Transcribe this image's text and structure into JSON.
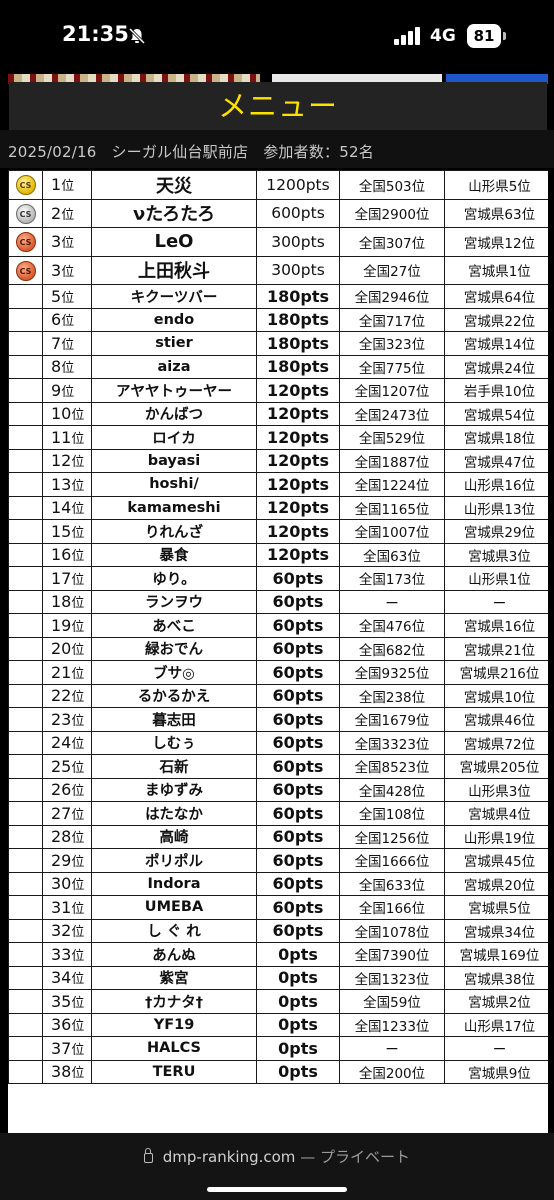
{
  "status_bar": {
    "time": "21:35",
    "network": "4G",
    "battery": "81",
    "icons": [
      "bell-slash-icon",
      "signal-icon",
      "battery-icon"
    ]
  },
  "header": {
    "menu_title": "メニュー",
    "date": "2025/02/16",
    "store": "シーガル仙台駅前店",
    "participants": "参加者数：52名"
  },
  "colors": {
    "menu_text": "#ffe100",
    "badge_gold": "#e2b600",
    "badge_silver": "#b4b4b4",
    "badge_bronze": "#d8592d"
  },
  "rankings": {
    "rank_suffix": "位",
    "rows": [
      {
        "badge": "gold",
        "badge_label": "CS",
        "rank": "1",
        "name": "天災",
        "pts": "1200pts",
        "national": "全国503位",
        "pref": "山形県5位"
      },
      {
        "badge": "silver",
        "badge_label": "CS",
        "rank": "2",
        "name": "νたろたろ",
        "pts": "600pts",
        "national": "全国2900位",
        "pref": "宮城県63位"
      },
      {
        "badge": "bronze",
        "badge_label": "CS",
        "rank": "3",
        "name": "LeO",
        "pts": "300pts",
        "national": "全国307位",
        "pref": "宮城県12位"
      },
      {
        "badge": "bronze",
        "badge_label": "CS",
        "rank": "3",
        "name": "上田秋斗",
        "pts": "300pts",
        "national": "全国27位",
        "pref": "宮城県1位"
      },
      {
        "badge": "",
        "badge_label": "",
        "rank": "5",
        "name": "キクーツバー",
        "pts": "180pts",
        "national": "全国2946位",
        "pref": "宮城県64位"
      },
      {
        "badge": "",
        "badge_label": "",
        "rank": "6",
        "name": "endo",
        "pts": "180pts",
        "national": "全国717位",
        "pref": "宮城県22位"
      },
      {
        "badge": "",
        "badge_label": "",
        "rank": "7",
        "name": "stier",
        "pts": "180pts",
        "national": "全国323位",
        "pref": "宮城県14位"
      },
      {
        "badge": "",
        "badge_label": "",
        "rank": "8",
        "name": "aiza",
        "pts": "180pts",
        "national": "全国775位",
        "pref": "宮城県24位"
      },
      {
        "badge": "",
        "badge_label": "",
        "rank": "9",
        "name": "アヤヤトゥーヤー",
        "pts": "120pts",
        "national": "全国1207位",
        "pref": "岩手県10位"
      },
      {
        "badge": "",
        "badge_label": "",
        "rank": "10",
        "name": "かんばつ",
        "pts": "120pts",
        "national": "全国2473位",
        "pref": "宮城県54位"
      },
      {
        "badge": "",
        "badge_label": "",
        "rank": "11",
        "name": "ロイカ",
        "pts": "120pts",
        "national": "全国529位",
        "pref": "宮城県18位"
      },
      {
        "badge": "",
        "badge_label": "",
        "rank": "12",
        "name": "bayasi",
        "pts": "120pts",
        "national": "全国1887位",
        "pref": "宮城県47位"
      },
      {
        "badge": "",
        "badge_label": "",
        "rank": "13",
        "name": "hoshi/",
        "pts": "120pts",
        "national": "全国1224位",
        "pref": "山形県16位"
      },
      {
        "badge": "",
        "badge_label": "",
        "rank": "14",
        "name": "kamameshi",
        "pts": "120pts",
        "national": "全国1165位",
        "pref": "山形県13位"
      },
      {
        "badge": "",
        "badge_label": "",
        "rank": "15",
        "name": "りれんざ",
        "pts": "120pts",
        "national": "全国1007位",
        "pref": "宮城県29位"
      },
      {
        "badge": "",
        "badge_label": "",
        "rank": "16",
        "name": "暴食",
        "pts": "120pts",
        "national": "全国63位",
        "pref": "宮城県3位"
      },
      {
        "badge": "",
        "badge_label": "",
        "rank": "17",
        "name": "ゆり。",
        "pts": "60pts",
        "national": "全国173位",
        "pref": "山形県1位"
      },
      {
        "badge": "",
        "badge_label": "",
        "rank": "18",
        "name": "ランヲウ",
        "pts": "60pts",
        "national": "ー",
        "pref": "ー"
      },
      {
        "badge": "",
        "badge_label": "",
        "rank": "19",
        "name": "あべこ",
        "pts": "60pts",
        "national": "全国476位",
        "pref": "宮城県16位"
      },
      {
        "badge": "",
        "badge_label": "",
        "rank": "20",
        "name": "緑おでん",
        "pts": "60pts",
        "national": "全国682位",
        "pref": "宮城県21位"
      },
      {
        "badge": "",
        "badge_label": "",
        "rank": "21",
        "name": "ブサ◎",
        "pts": "60pts",
        "national": "全国9325位",
        "pref": "宮城県216位"
      },
      {
        "badge": "",
        "badge_label": "",
        "rank": "22",
        "name": "るかるかえ",
        "pts": "60pts",
        "national": "全国238位",
        "pref": "宮城県10位"
      },
      {
        "badge": "",
        "badge_label": "",
        "rank": "23",
        "name": "暮志田",
        "pts": "60pts",
        "national": "全国1679位",
        "pref": "宮城県46位"
      },
      {
        "badge": "",
        "badge_label": "",
        "rank": "24",
        "name": "しむぅ",
        "pts": "60pts",
        "national": "全国3323位",
        "pref": "宮城県72位"
      },
      {
        "badge": "",
        "badge_label": "",
        "rank": "25",
        "name": "石新",
        "pts": "60pts",
        "national": "全国8523位",
        "pref": "宮城県205位"
      },
      {
        "badge": "",
        "badge_label": "",
        "rank": "26",
        "name": "まゆずみ",
        "pts": "60pts",
        "national": "全国428位",
        "pref": "山形県3位"
      },
      {
        "badge": "",
        "badge_label": "",
        "rank": "27",
        "name": "はたなか",
        "pts": "60pts",
        "national": "全国108位",
        "pref": "宮城県4位"
      },
      {
        "badge": "",
        "badge_label": "",
        "rank": "28",
        "name": "高崎",
        "pts": "60pts",
        "national": "全国1256位",
        "pref": "山形県19位"
      },
      {
        "badge": "",
        "badge_label": "",
        "rank": "29",
        "name": "ポリポル",
        "pts": "60pts",
        "national": "全国1666位",
        "pref": "宮城県45位"
      },
      {
        "badge": "",
        "badge_label": "",
        "rank": "30",
        "name": "Indora",
        "pts": "60pts",
        "national": "全国633位",
        "pref": "宮城県20位"
      },
      {
        "badge": "",
        "badge_label": "",
        "rank": "31",
        "name": "UMEBA",
        "pts": "60pts",
        "national": "全国166位",
        "pref": "宮城県5位"
      },
      {
        "badge": "",
        "badge_label": "",
        "rank": "32",
        "name": "し ぐ れ",
        "pts": "60pts",
        "national": "全国1078位",
        "pref": "宮城県34位"
      },
      {
        "badge": "",
        "badge_label": "",
        "rank": "33",
        "name": "あんぬ",
        "pts": "0pts",
        "national": "全国7390位",
        "pref": "宮城県169位"
      },
      {
        "badge": "",
        "badge_label": "",
        "rank": "34",
        "name": "紫宮",
        "pts": "0pts",
        "national": "全国1323位",
        "pref": "宮城県38位"
      },
      {
        "badge": "",
        "badge_label": "",
        "rank": "35",
        "name": "†カナタ†",
        "pts": "0pts",
        "national": "全国59位",
        "pref": "宮城県2位"
      },
      {
        "badge": "",
        "badge_label": "",
        "rank": "36",
        "name": "YF19",
        "pts": "0pts",
        "national": "全国1233位",
        "pref": "山形県17位"
      },
      {
        "badge": "",
        "badge_label": "",
        "rank": "37",
        "name": "HALCS",
        "pts": "0pts",
        "national": "ー",
        "pref": "ー"
      },
      {
        "badge": "",
        "badge_label": "",
        "rank": "38",
        "name": "TERU",
        "pts": "0pts",
        "national": "全国200位",
        "pref": "宮城県9位"
      }
    ]
  },
  "browser": {
    "url": "dmp-ranking.com",
    "separator": "—",
    "mode": "プライベート"
  }
}
